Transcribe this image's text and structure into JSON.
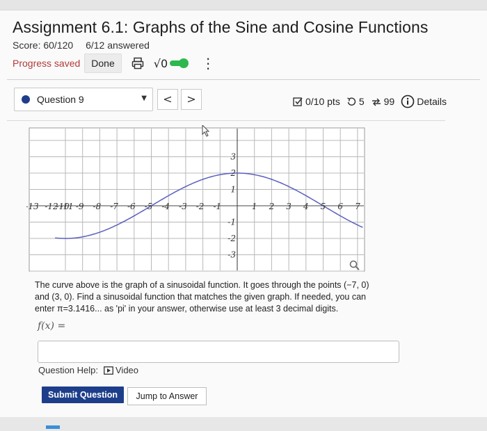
{
  "assignment": {
    "title": "Assignment 6.1: Graphs of the Sine and Cosine Functions",
    "score": "Score: 60/120",
    "answered": "6/12 answered"
  },
  "toolbar": {
    "progress": "Progress saved",
    "done": "Done",
    "sqrt": "√0"
  },
  "question": {
    "label": "Question 9",
    "prev": "<",
    "next": ">",
    "points": "0/10 pts",
    "retries": "5",
    "attempts": "99",
    "details": "Details"
  },
  "graph": {
    "x_ticks": [
      "13",
      "12",
      "11",
      "10",
      "9",
      "8",
      "7",
      "6",
      "5",
      "4",
      "3",
      "2",
      "1",
      "1",
      "2",
      "3",
      "4",
      "5",
      "6",
      "7"
    ],
    "x_tick_values": [
      -13,
      -12,
      -11,
      -10,
      -9,
      -8,
      -7,
      -6,
      -5,
      -4,
      -3,
      -2,
      -1,
      1,
      2,
      3,
      4,
      5,
      6,
      7
    ],
    "y_ticks": [
      "3",
      "2",
      "1",
      "-1",
      "-2",
      "-3"
    ],
    "y_tick_values": [
      3,
      2,
      1,
      -1,
      -2,
      -3
    ],
    "curve": {
      "amplitude": 2,
      "period": 20,
      "max_at_x": 0,
      "description": "sinusoid through (-7,0) and (3,0)"
    },
    "curve_color": "#5a5fbf"
  },
  "problem": {
    "line1": "The curve above is the graph of a sinusoidal function. It goes through the points (−7, 0)",
    "line2": "and (3, 0). Find a sinusoidal function that matches the given graph. If needed, you can",
    "line3": "enter π=3.1416... as 'pi' in your answer, otherwise use at least 3 decimal digits.",
    "fx": "f(x) ="
  },
  "help": {
    "label": "Question Help:",
    "video": "Video"
  },
  "buttons": {
    "submit": "Submit Question",
    "jump": "Jump to Answer"
  },
  "colors": {
    "accent": "#1d3e8a",
    "progress": "#b23a3a",
    "toggle": "#2db84d"
  }
}
